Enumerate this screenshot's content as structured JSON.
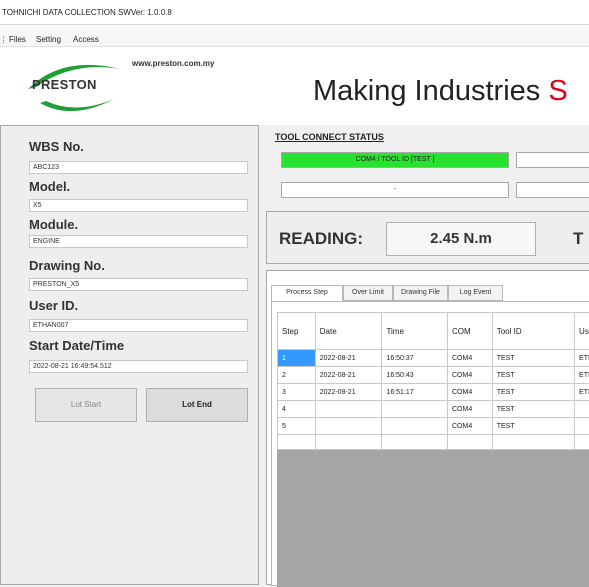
{
  "window": {
    "title": "TOHNICHI DATA COLLECTION SWVer: 1.0.0.8"
  },
  "menu": [
    "Files",
    "Setting",
    "Access"
  ],
  "header": {
    "logo_text": "PRESTON",
    "url": "www.preston.com.my",
    "title_main": "Making Industries ",
    "title_accent": "S",
    "accent_color": "#e2001a"
  },
  "form": {
    "wbs_label": "WBS No.",
    "wbs_value": "ABC123",
    "model_label": "Model.",
    "model_value": "X5",
    "module_label": "Module.",
    "module_value": "ENGINE",
    "drawing_label": "Drawing No.",
    "drawing_value": "PRESTON_X5",
    "user_label": "User ID.",
    "user_value": "ETHAN007",
    "start_label": "Start Date/Time",
    "start_value": "2022-08-21 16:49:54.512",
    "lot_start_label": "Lot Start",
    "lot_end_label": "Lot End"
  },
  "tool_status": {
    "heading": "TOOL CONNECT STATUS",
    "connection_text": "COM4 / TOOL ID [TEST ]",
    "connection_color": "#27e22e",
    "second_text": "-"
  },
  "reading": {
    "label": "READING:",
    "value": "2.45 N.m",
    "next_label": "T"
  },
  "tabs": [
    "Process Step",
    "Over Limit",
    "Drawing File",
    "Log Event"
  ],
  "table": {
    "columns": [
      "Step",
      "Date",
      "Time",
      "COM",
      "Tool ID",
      "Us"
    ],
    "rows": [
      [
        "1",
        "2022-08-21",
        "16:50:37",
        "COM4",
        "TEST",
        "ETI"
      ],
      [
        "2",
        "2022-08-21",
        "16:50:43",
        "COM4",
        "TEST",
        "ETI"
      ],
      [
        "3",
        "2022-08-21",
        "16:51:17",
        "COM4",
        "TEST",
        "ETI"
      ],
      [
        "4",
        "",
        "",
        "COM4",
        "TEST",
        ""
      ],
      [
        "5",
        "",
        "",
        "COM4",
        "TEST",
        ""
      ]
    ]
  }
}
